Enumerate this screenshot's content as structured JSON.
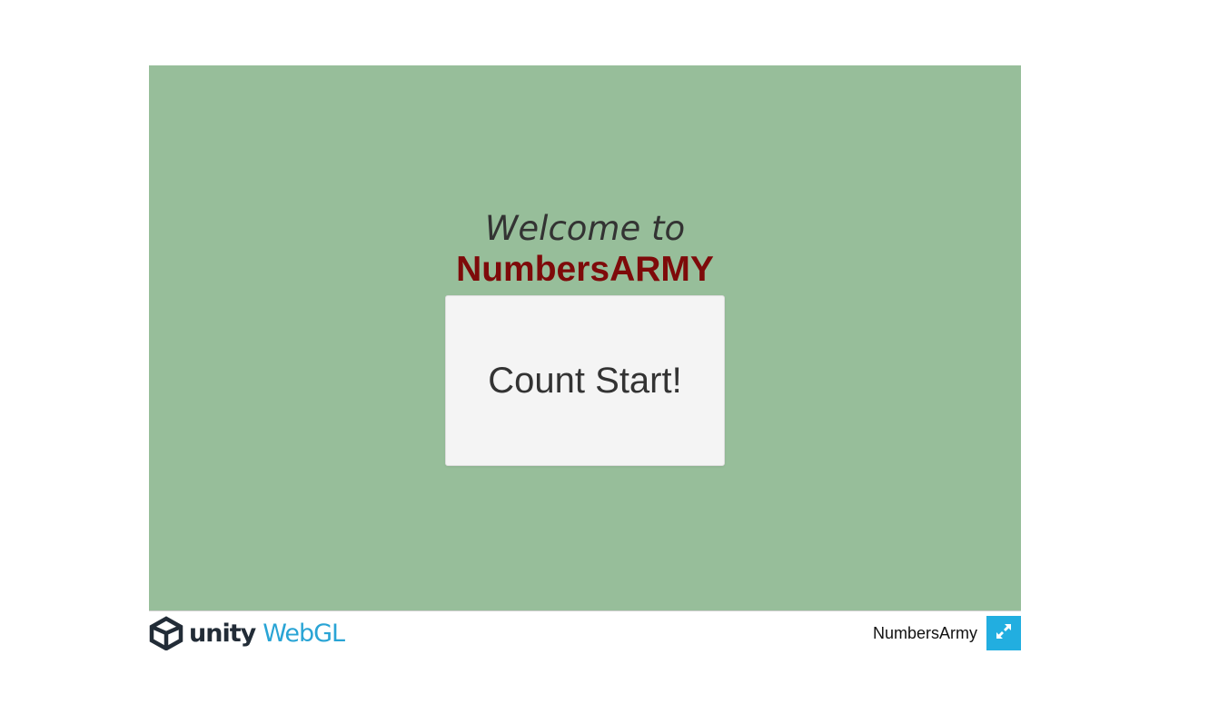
{
  "game": {
    "welcome_text": "Welcome to",
    "title_text": "NumbersARMY",
    "start_button_label": "Count Start!"
  },
  "footer": {
    "logo_unity": "unity",
    "logo_webgl": "WebGL",
    "build_title": "NumbersArmy",
    "fullscreen_icon": "fullscreen-expand-icon"
  },
  "colors": {
    "canvas_background": "#97be9a",
    "title": "#7e0a0a",
    "welcome": "#333333",
    "button_background": "#f4f4f4",
    "unity_dark": "#222c37",
    "webgl_blue": "#29a4d5",
    "fullscreen_button": "#22aee0"
  }
}
